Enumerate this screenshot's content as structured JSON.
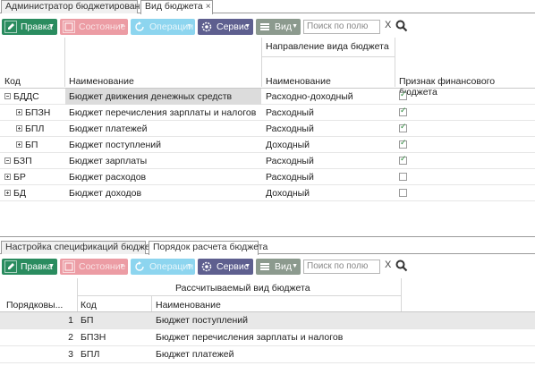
{
  "top_tabs": [
    {
      "label": "Администратор бюджетирования",
      "active": false
    },
    {
      "label": "Вид бюджета",
      "active": true,
      "close": "×"
    }
  ],
  "toolbar1": {
    "edit": "Правка",
    "state": "Состояние",
    "operations": "Операции",
    "service": "Сервис",
    "view": "Вид",
    "search_placeholder": "Поиск по полю",
    "clear": "X"
  },
  "grid1": {
    "group_header": "Направление вида бюджета",
    "columns": {
      "code": "Код",
      "name": "Наименование",
      "direction_name": "Наименование",
      "fin_flag": "Признак финансового бюджета"
    },
    "rows": [
      {
        "code": "БДДС",
        "name": "Бюджет движения денежных средств",
        "direction": "Расходно-доходный",
        "checked": true,
        "level": 0,
        "expander": "minus"
      },
      {
        "code": "БПЗН",
        "name": "Бюджет перечисления зарплаты и налогов",
        "direction": "Расходный",
        "checked": true,
        "level": 1,
        "expander": "plus"
      },
      {
        "code": "БПЛ",
        "name": "Бюджет платежей",
        "direction": "Расходный",
        "checked": true,
        "level": 1,
        "expander": "plus"
      },
      {
        "code": "БП",
        "name": "Бюджет поступлений",
        "direction": "Доходный",
        "checked": true,
        "level": 1,
        "expander": "plus"
      },
      {
        "code": "БЗП",
        "name": "Бюджет зарплаты",
        "direction": "Расходный",
        "checked": true,
        "level": 0,
        "expander": "minus"
      },
      {
        "code": "БР",
        "name": "Бюджет расходов",
        "direction": "Расходный",
        "checked": false,
        "level": 0,
        "expander": "plus"
      },
      {
        "code": "БД",
        "name": "Бюджет доходов",
        "direction": "Доходный",
        "checked": false,
        "level": 0,
        "expander": "plus"
      }
    ]
  },
  "bottom_tabs": [
    {
      "label": "Настройка спецификаций бюджета",
      "active": false
    },
    {
      "label": "Порядок расчета бюджета",
      "active": true
    }
  ],
  "toolbar2": {
    "edit": "Правка",
    "state": "Состояние",
    "operations": "Операции",
    "service": "Сервис",
    "view": "Вид",
    "search_placeholder": "Поиск по полю",
    "clear": "X"
  },
  "grid2": {
    "group_header": "Рассчитываемый вид бюджета",
    "columns": {
      "order": "Порядковы...",
      "code": "Код",
      "name": "Наименование"
    },
    "rows": [
      {
        "order": "1",
        "code": "БП",
        "name": "Бюджет поступлений"
      },
      {
        "order": "2",
        "code": "БПЗН",
        "name": "Бюджет перечисления зарплаты и налогов"
      },
      {
        "order": "3",
        "code": "БПЛ",
        "name": "Бюджет платежей"
      }
    ]
  },
  "colors": {
    "green": "#2a8c5f",
    "pink": "#ec9ca4",
    "cyan": "#8dd5ef",
    "purple": "#5e5f8f",
    "gray": "#8c9a8e",
    "check": "#2e8b3d"
  }
}
